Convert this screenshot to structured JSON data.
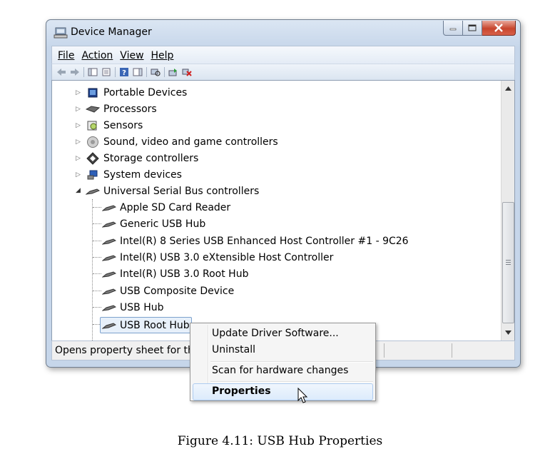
{
  "window": {
    "title": "Device Manager"
  },
  "menu": {
    "file": "File",
    "action": "Action",
    "view": "View",
    "help": "Help"
  },
  "tree": {
    "categories": [
      {
        "label": "Portable Devices",
        "icon": "portable-devices-icon"
      },
      {
        "label": "Processors",
        "icon": "processor-icon"
      },
      {
        "label": "Sensors",
        "icon": "sensor-icon"
      },
      {
        "label": "Sound, video and game controllers",
        "icon": "speaker-icon"
      },
      {
        "label": "Storage controllers",
        "icon": "storage-icon"
      },
      {
        "label": "System devices",
        "icon": "system-devices-icon"
      }
    ],
    "usb_category": {
      "label": "Universal Serial Bus controllers",
      "icon": "usb-icon"
    },
    "usb_children": [
      "Apple SD Card Reader",
      "Generic USB Hub",
      "Intel(R) 8 Series USB Enhanced Host Controller #1 - 9C26",
      "Intel(R) USB 3.0 eXtensible Host Controller",
      "Intel(R) USB 3.0 Root Hub",
      "USB Composite Device",
      "USB Hub",
      "USB Root Hub"
    ],
    "selected_index": 7
  },
  "status": {
    "text": "Opens property sheet for the"
  },
  "context_menu": {
    "update_driver": "Update Driver Software...",
    "uninstall": "Uninstall",
    "scan": "Scan for hardware changes",
    "properties": "Properties"
  },
  "caption": "Figure 4.11: USB Hub Properties",
  "colors": {
    "selection_border": "#7da2ce",
    "selection_fill": "#e7f0fa",
    "close_button": "#c7452d"
  }
}
